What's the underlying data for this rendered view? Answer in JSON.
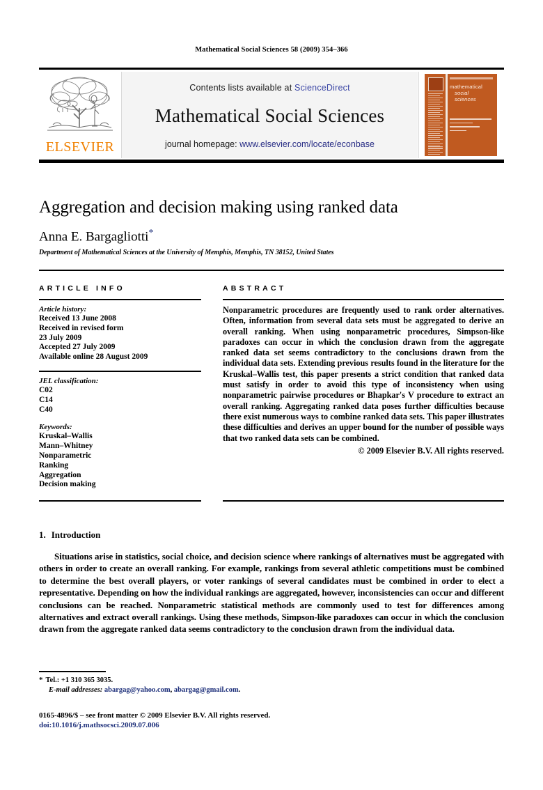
{
  "running_head": "Mathematical Social Sciences 58 (2009) 354–366",
  "masthead": {
    "contents_line": "Contents lists available at ",
    "sciencedirect": "ScienceDirect",
    "journal_name": "Mathematical Social Sciences",
    "homepage_label": "journal homepage: ",
    "homepage_url": "www.elsevier.com/locate/econbase",
    "publisher": "ELSEVIER",
    "cover": {
      "line1": "mathematical",
      "line2": "social",
      "line3": "sciences"
    },
    "colors": {
      "sciencedirect_blue": "#3b46a5",
      "homepage_blue": "#2a2f86",
      "elsevier_orange": "#F08000",
      "cover_orange": "#c05a20",
      "banner_background": "#f4f4f4"
    }
  },
  "article": {
    "title": "Aggregation and decision making using ranked data",
    "author": "Anna E. Bargagliotti",
    "author_marker": "*",
    "affiliation": "Department of Mathematical Sciences at the University of Memphis, Memphis, TN 38152, United States"
  },
  "info": {
    "heading": "ARTICLE INFO",
    "history_label": "Article history:",
    "history": [
      "Received 13 June 2008",
      "Received in revised form",
      "23 July 2009",
      "Accepted 27 July 2009",
      "Available online 28 August 2009"
    ],
    "jel_label": "JEL classification:",
    "jel": [
      "C02",
      "C14",
      "C40"
    ],
    "keywords_label": "Keywords:",
    "keywords": [
      "Kruskal–Wallis",
      "Mann–Whitney",
      "Nonparametric",
      "Ranking",
      "Aggregation",
      "Decision making"
    ]
  },
  "abstract": {
    "heading": "ABSTRACT",
    "text": "Nonparametric procedures are frequently used to rank order alternatives. Often, information from several data sets must be aggregated to derive an overall ranking. When using nonparametric procedures, Simpson-like paradoxes can occur in which the conclusion drawn from the aggregate ranked data set seems contradictory to the conclusions drawn from the individual data sets. Extending previous results found in the literature for the Kruskal–Wallis test, this paper presents a strict condition that ranked data must satisfy in order to avoid this type of inconsistency when using nonparametric pairwise procedures or Bhapkar's V procedure to extract an overall ranking. Aggregating ranked data poses further difficulties because there exist numerous ways to combine ranked data sets. This paper illustrates these difficulties and derives an upper bound for the number of possible ways that two ranked data sets can be combined.",
    "copyright": "© 2009 Elsevier B.V. All rights reserved."
  },
  "body": {
    "section_number": "1.",
    "section_title": "Introduction",
    "paragraph": "Situations arise in statistics, social choice, and decision science where rankings of alternatives must be aggregated with others in order to create an overall ranking. For example, rankings from several athletic competitions must be combined to determine the best overall players, or voter rankings of several candidates must be combined in order to elect a representative. Depending on how the individual rankings are aggregated, however, inconsistencies can occur and different conclusions can be reached. Nonparametric statistical methods are commonly used to test for differences among alternatives and extract overall rankings. Using these methods, Simpson-like paradoxes can occur in which the conclusion drawn from the aggregate ranked data seems contradictory to the conclusion drawn from the individual data."
  },
  "footnotes": {
    "marker": "*",
    "tel": "Tel.: +1 310 365 3035.",
    "email_label": "E-mail addresses:",
    "email1": "abargag@yahoo.com",
    "email_sep": ", ",
    "email2": "abargag@gmail.com",
    "email_end": "."
  },
  "colophon": {
    "issn_line": "0165-4896/$ – see front matter © 2009 Elsevier B.V. All rights reserved.",
    "doi": "doi:10.1016/j.mathsocsci.2009.07.006"
  }
}
